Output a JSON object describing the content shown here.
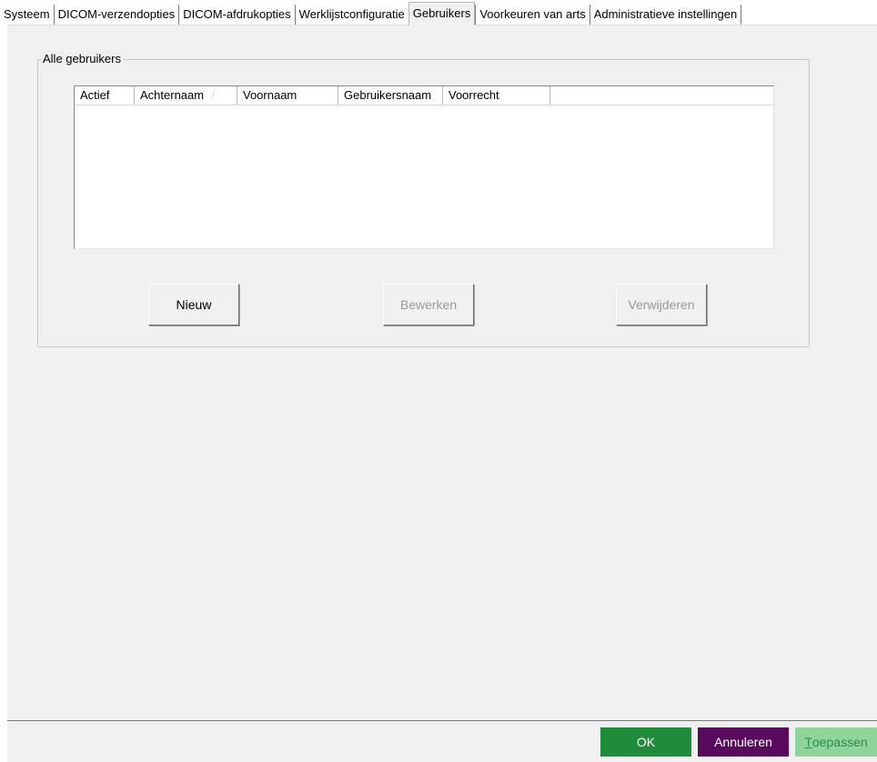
{
  "tabs": [
    {
      "label": "Systeem",
      "active": false
    },
    {
      "label": "DICOM-verzendopties",
      "active": false
    },
    {
      "label": "DICOM-afdrukopties",
      "active": false
    },
    {
      "label": "Werklijstconfiguratie",
      "active": false
    },
    {
      "label": "Gebruikers",
      "active": true
    },
    {
      "label": "Voorkeuren van arts",
      "active": false
    },
    {
      "label": "Administratieve instellingen",
      "active": false
    }
  ],
  "group": {
    "title": "Alle gebruikers",
    "columns": [
      "Actief",
      "Achternaam",
      "Voornaam",
      "Gebruikersnaam",
      "Voorrecht"
    ],
    "sort_column": "Achternaam",
    "sort_direction": "ascending",
    "rows": []
  },
  "buttons": {
    "new_label": "Nieuw",
    "edit_label": "Bewerken",
    "delete_label": "Verwijderen"
  },
  "footer": {
    "ok_label": "OK",
    "cancel_label": "Annuleren",
    "apply_label": "Toepassen"
  },
  "colors": {
    "ok_bg": "#1e8c3a",
    "cancel_bg": "#5a0a5e",
    "apply_bg": "#8fd49a",
    "apply_text": "#2e8b57",
    "panel_bg": "#f0f0f0"
  }
}
